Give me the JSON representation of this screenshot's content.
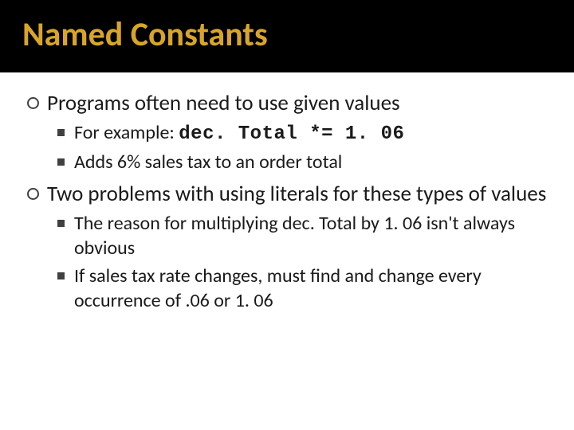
{
  "title": "Named Constants",
  "bullets": [
    {
      "level": 1,
      "text": "Programs often need to use given values"
    },
    {
      "level": 2,
      "prefix": "For example: ",
      "code": "dec. Total *= 1. 06"
    },
    {
      "level": 2,
      "text": "Adds 6% sales tax to an order total"
    },
    {
      "level": 1,
      "text": "Two problems with using literals for these types of values"
    },
    {
      "level": 2,
      "text": "The reason for multiplying dec. Total by 1. 06  isn't always obvious"
    },
    {
      "level": 2,
      "text": "If sales tax rate changes, must find and change every occurrence of .06 or 1. 06"
    }
  ]
}
